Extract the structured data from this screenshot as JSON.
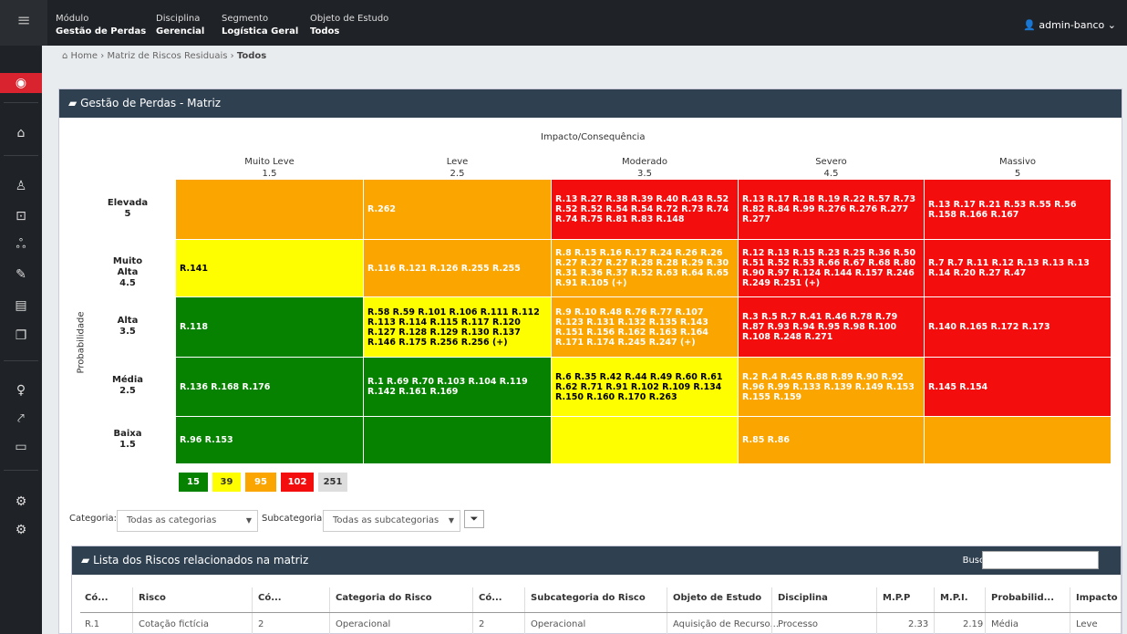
{
  "topbar": {
    "modulo_l": "Módulo",
    "modulo_v": "Gestão de Perdas",
    "disc_l": "Disciplina",
    "disc_v": "Gerencial",
    "seg_l": "Segmento",
    "seg_v": "Logística Geral",
    "obj_l": "Objeto de Estudo",
    "obj_v": "Todos",
    "user": "admin-banco"
  },
  "breadcrumb": {
    "home": "Home",
    "matriz": "Matriz de Riscos Residuais",
    "current": "Todos"
  },
  "panel_title": "Gestão de Perdas - Matriz",
  "matrix": {
    "impact_title": "Impacto/Consequência",
    "prob_title": "Probabilidade",
    "cols": [
      {
        "name": "Muito Leve",
        "v": "1.5"
      },
      {
        "name": "Leve",
        "v": "2.5"
      },
      {
        "name": "Moderado",
        "v": "3.5"
      },
      {
        "name": "Severo",
        "v": "4.5"
      },
      {
        "name": "Massivo",
        "v": "5"
      }
    ],
    "rows": [
      {
        "name": "Elevada",
        "v": "5",
        "cells": [
          "",
          "R.262",
          "R.13 R.27 R.38 R.39 R.40 R.43 R.52 R.52 R.52 R.54 R.54 R.72 R.73 R.74 R.74 R.75 R.81 R.83 R.148",
          "R.13 R.17 R.18 R.19 R.22 R.57 R.73 R.82 R.84 R.99 R.276 R.276 R.277 R.277",
          "R.13 R.17 R.21 R.53 R.55 R.56 R.158 R.166 R.167"
        ]
      },
      {
        "name": "Muito Alta",
        "v": "4.5",
        "cells": [
          "R.141",
          "R.116 R.121 R.126 R.255 R.255",
          "R.8 R.15 R.16 R.17 R.24 R.26 R.26 R.27 R.27 R.27 R.28 R.28 R.29 R.30 R.31 R.36 R.37 R.52 R.63 R.64 R.65 R.91 R.105 (+)",
          "R.12 R.13 R.15 R.23 R.25 R.36 R.50 R.51 R.52 R.53 R.66 R.67 R.68 R.80 R.90 R.97 R.124 R.144 R.157 R.246 R.249 R.251 (+)",
          "R.7 R.7 R.11 R.12 R.13 R.13 R.13 R.14 R.20 R.27 R.47"
        ]
      },
      {
        "name": "Alta",
        "v": "3.5",
        "cells": [
          "R.118",
          "R.58 R.59 R.101 R.106 R.111 R.112 R.113 R.114 R.115 R.117 R.120 R.127 R.128 R.129 R.130 R.137 R.146 R.175 R.256 R.256 (+)",
          "R.9 R.10 R.48 R.76 R.77 R.107 R.123 R.131 R.132 R.135 R.143 R.151 R.156 R.162 R.163 R.164 R.171 R.174 R.245 R.247 (+)",
          "R.3 R.5 R.7 R.41 R.46 R.78 R.79 R.87 R.93 R.94 R.95 R.98 R.100 R.108 R.248 R.271",
          "R.140 R.165 R.172 R.173"
        ]
      },
      {
        "name": "Média",
        "v": "2.5",
        "cells": [
          "R.136 R.168 R.176",
          "R.1 R.69 R.70 R.103 R.104 R.119 R.142 R.161 R.169",
          "R.6 R.35 R.42 R.44 R.49 R.60 R.61 R.62 R.71 R.91 R.102 R.109 R.134 R.150 R.160 R.170 R.263",
          "R.2 R.4 R.45 R.88 R.89 R.90 R.92 R.96 R.99 R.133 R.139 R.149 R.153 R.155 R.159",
          "R.145 R.154"
        ]
      },
      {
        "name": "Baixa",
        "v": "1.5",
        "cells": [
          "R.96 R.153",
          "",
          "",
          "R.85 R.86",
          ""
        ]
      }
    ]
  },
  "legend": [
    "15",
    "39",
    "95",
    "102",
    "251"
  ],
  "filters": {
    "cat_label": "Categoria:",
    "cat_value": "Todas as categorias",
    "sub_label": "Subcategoria:",
    "sub_value": "Todas as subcategorias"
  },
  "list": {
    "title": "Lista dos Riscos relacionados na matriz",
    "busca": "Busca:",
    "headers": [
      "Có...",
      "Risco",
      "Có...",
      "Categoria do Risco",
      "Có...",
      "Subcategoria do Risco",
      "Objeto de Estudo",
      "Disciplina",
      "M.P.P",
      "M.P.I.",
      "Probabilid...",
      "Impacto"
    ],
    "row": [
      "R.1",
      "Cotação fictícia",
      "2",
      "Operacional",
      "2",
      "Operacional",
      "Aquisição de Recurso...",
      "Processo",
      "2.33",
      "2.19",
      "Média",
      "Leve"
    ]
  }
}
